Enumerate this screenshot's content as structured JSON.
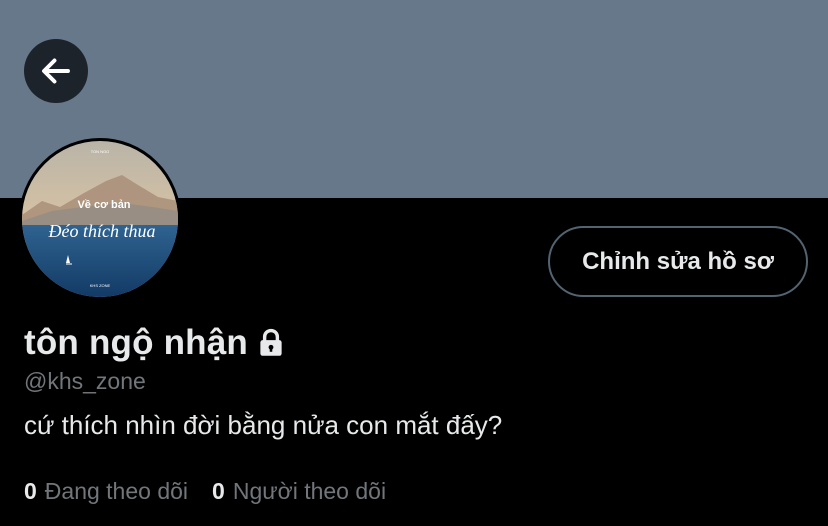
{
  "header": {
    "back_icon": "arrow-left-icon",
    "banner_color": "#66788a"
  },
  "avatar": {
    "text_top": "Về cơ bản",
    "text_script": "Đéo thích thua",
    "text_small_top": "TON NGO",
    "text_small_bottom": "KHS ZONE"
  },
  "actions": {
    "edit_profile_label": "Chỉnh sửa hồ sơ"
  },
  "profile": {
    "display_name": "tôn ngộ nhận",
    "lock_icon": "lock-icon",
    "handle": "@khs_zone",
    "bio": "cứ thích nhìn đời bằng nửa con mắt đấy?"
  },
  "stats": {
    "following_count": "0",
    "following_label": "Đang theo dõi",
    "followers_count": "0",
    "followers_label": "Người theo dõi"
  },
  "colors": {
    "background": "#000000",
    "primary_text": "#e7e9ea",
    "secondary_text": "#71767b",
    "button_border": "#536471"
  }
}
